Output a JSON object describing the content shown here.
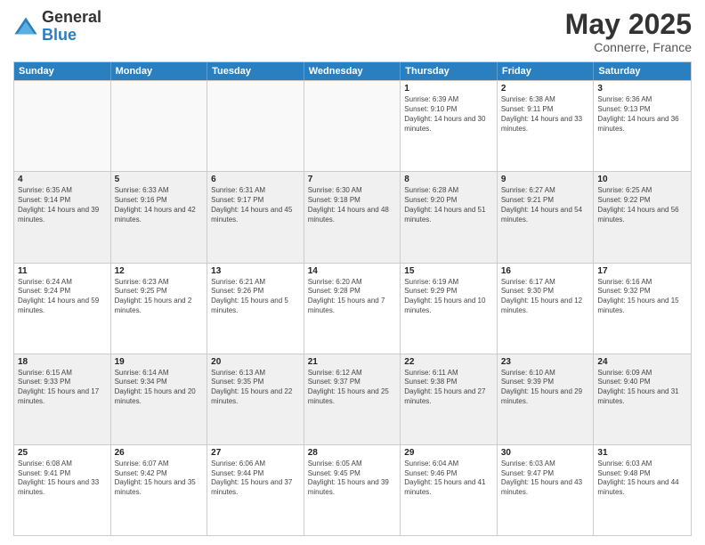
{
  "header": {
    "logo_general": "General",
    "logo_blue": "Blue",
    "month_title": "May 2025",
    "location": "Connerre, France"
  },
  "weekdays": [
    "Sunday",
    "Monday",
    "Tuesday",
    "Wednesday",
    "Thursday",
    "Friday",
    "Saturday"
  ],
  "rows": [
    [
      {
        "day": "",
        "empty": true
      },
      {
        "day": "",
        "empty": true
      },
      {
        "day": "",
        "empty": true
      },
      {
        "day": "",
        "empty": true
      },
      {
        "day": "1",
        "sunrise": "6:39 AM",
        "sunset": "9:10 PM",
        "daylight": "14 hours and 30 minutes."
      },
      {
        "day": "2",
        "sunrise": "6:38 AM",
        "sunset": "9:11 PM",
        "daylight": "14 hours and 33 minutes."
      },
      {
        "day": "3",
        "sunrise": "6:36 AM",
        "sunset": "9:13 PM",
        "daylight": "14 hours and 36 minutes."
      }
    ],
    [
      {
        "day": "4",
        "sunrise": "6:35 AM",
        "sunset": "9:14 PM",
        "daylight": "14 hours and 39 minutes."
      },
      {
        "day": "5",
        "sunrise": "6:33 AM",
        "sunset": "9:16 PM",
        "daylight": "14 hours and 42 minutes."
      },
      {
        "day": "6",
        "sunrise": "6:31 AM",
        "sunset": "9:17 PM",
        "daylight": "14 hours and 45 minutes."
      },
      {
        "day": "7",
        "sunrise": "6:30 AM",
        "sunset": "9:18 PM",
        "daylight": "14 hours and 48 minutes."
      },
      {
        "day": "8",
        "sunrise": "6:28 AM",
        "sunset": "9:20 PM",
        "daylight": "14 hours and 51 minutes."
      },
      {
        "day": "9",
        "sunrise": "6:27 AM",
        "sunset": "9:21 PM",
        "daylight": "14 hours and 54 minutes."
      },
      {
        "day": "10",
        "sunrise": "6:25 AM",
        "sunset": "9:22 PM",
        "daylight": "14 hours and 56 minutes."
      }
    ],
    [
      {
        "day": "11",
        "sunrise": "6:24 AM",
        "sunset": "9:24 PM",
        "daylight": "14 hours and 59 minutes."
      },
      {
        "day": "12",
        "sunrise": "6:23 AM",
        "sunset": "9:25 PM",
        "daylight": "15 hours and 2 minutes."
      },
      {
        "day": "13",
        "sunrise": "6:21 AM",
        "sunset": "9:26 PM",
        "daylight": "15 hours and 5 minutes."
      },
      {
        "day": "14",
        "sunrise": "6:20 AM",
        "sunset": "9:28 PM",
        "daylight": "15 hours and 7 minutes."
      },
      {
        "day": "15",
        "sunrise": "6:19 AM",
        "sunset": "9:29 PM",
        "daylight": "15 hours and 10 minutes."
      },
      {
        "day": "16",
        "sunrise": "6:17 AM",
        "sunset": "9:30 PM",
        "daylight": "15 hours and 12 minutes."
      },
      {
        "day": "17",
        "sunrise": "6:16 AM",
        "sunset": "9:32 PM",
        "daylight": "15 hours and 15 minutes."
      }
    ],
    [
      {
        "day": "18",
        "sunrise": "6:15 AM",
        "sunset": "9:33 PM",
        "daylight": "15 hours and 17 minutes."
      },
      {
        "day": "19",
        "sunrise": "6:14 AM",
        "sunset": "9:34 PM",
        "daylight": "15 hours and 20 minutes."
      },
      {
        "day": "20",
        "sunrise": "6:13 AM",
        "sunset": "9:35 PM",
        "daylight": "15 hours and 22 minutes."
      },
      {
        "day": "21",
        "sunrise": "6:12 AM",
        "sunset": "9:37 PM",
        "daylight": "15 hours and 25 minutes."
      },
      {
        "day": "22",
        "sunrise": "6:11 AM",
        "sunset": "9:38 PM",
        "daylight": "15 hours and 27 minutes."
      },
      {
        "day": "23",
        "sunrise": "6:10 AM",
        "sunset": "9:39 PM",
        "daylight": "15 hours and 29 minutes."
      },
      {
        "day": "24",
        "sunrise": "6:09 AM",
        "sunset": "9:40 PM",
        "daylight": "15 hours and 31 minutes."
      }
    ],
    [
      {
        "day": "25",
        "sunrise": "6:08 AM",
        "sunset": "9:41 PM",
        "daylight": "15 hours and 33 minutes."
      },
      {
        "day": "26",
        "sunrise": "6:07 AM",
        "sunset": "9:42 PM",
        "daylight": "15 hours and 35 minutes."
      },
      {
        "day": "27",
        "sunrise": "6:06 AM",
        "sunset": "9:44 PM",
        "daylight": "15 hours and 37 minutes."
      },
      {
        "day": "28",
        "sunrise": "6:05 AM",
        "sunset": "9:45 PM",
        "daylight": "15 hours and 39 minutes."
      },
      {
        "day": "29",
        "sunrise": "6:04 AM",
        "sunset": "9:46 PM",
        "daylight": "15 hours and 41 minutes."
      },
      {
        "day": "30",
        "sunrise": "6:03 AM",
        "sunset": "9:47 PM",
        "daylight": "15 hours and 43 minutes."
      },
      {
        "day": "31",
        "sunrise": "6:03 AM",
        "sunset": "9:48 PM",
        "daylight": "15 hours and 44 minutes."
      }
    ]
  ]
}
